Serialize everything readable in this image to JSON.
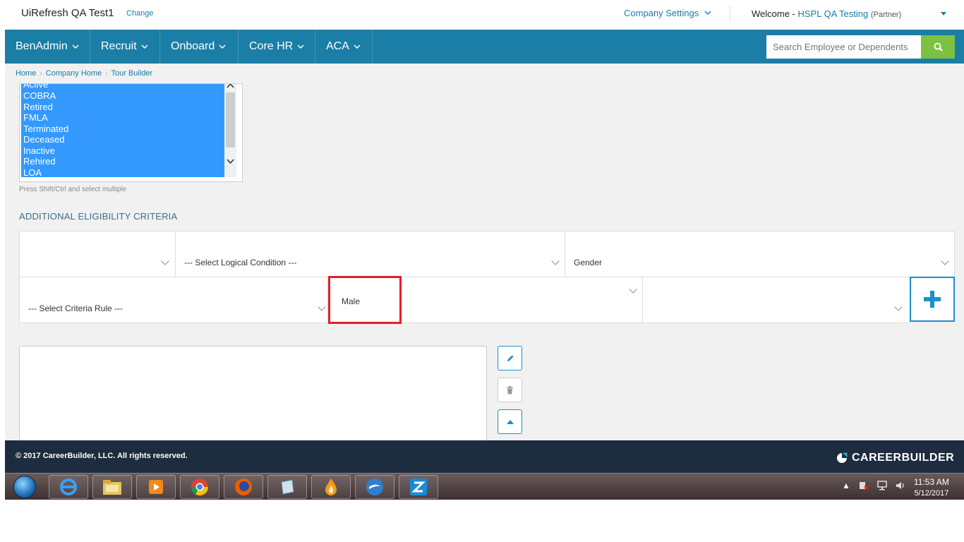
{
  "header": {
    "company_title": "UiRefresh QA Test1",
    "change_label": "Change",
    "company_settings_label": "Company Settings",
    "welcome_label": "Welcome - ",
    "user_name": "HSPL QA Testing",
    "user_role": "(Partner)"
  },
  "nav": {
    "items": [
      {
        "label": "BenAdmin"
      },
      {
        "label": "Recruit"
      },
      {
        "label": "Onboard"
      },
      {
        "label": "Core HR"
      },
      {
        "label": "ACA"
      }
    ],
    "search_placeholder": "Search Employee or Dependents"
  },
  "breadcrumb": {
    "items": [
      "Home",
      "Company Home",
      "Tour Builder"
    ]
  },
  "status_list": {
    "options": [
      "Active",
      "COBRA",
      "Retired",
      "FMLA",
      "Terminated",
      "Deceased",
      "Inactive",
      "Rehired",
      "LOA"
    ],
    "helper_text": "Press Shift/Ctrl and select multiple"
  },
  "eligibility": {
    "section_title": "ADDITIONAL ELIGIBILITY CRITERIA",
    "row1": {
      "first_value": "",
      "logical_condition_placeholder": "--- Select Logical Condition ---",
      "field_value": "Gender"
    },
    "row2": {
      "criteria_rule_placeholder": "--- Select Criteria Rule ---",
      "value": "Male",
      "last_value": ""
    }
  },
  "footer": {
    "copyright": "© 2017 CareerBuilder, LLC. All rights reserved.",
    "logo_text": "CAREERBUILDER"
  },
  "taskbar": {
    "time": "11:53 AM",
    "date": "5/12/2017"
  },
  "colors": {
    "nav_bg": "#1b7ea6",
    "accent": "#1a7ba8",
    "search_button": "#7cc242",
    "footer_bg": "#1d2c3f",
    "selection": "#3399ff",
    "highlight": "#e0202c"
  }
}
